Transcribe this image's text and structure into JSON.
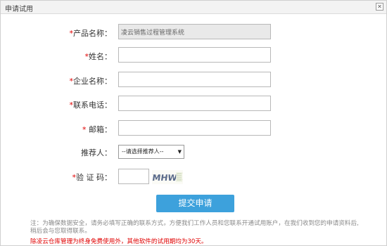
{
  "window": {
    "title": "申请试用",
    "close_icon": "close-icon",
    "close_glyph": "✕"
  },
  "form": {
    "product_name": {
      "required_mark": "*",
      "label": "产品名称：",
      "value": "凌云销售过程管理系统"
    },
    "name": {
      "required_mark": "*",
      "label": "姓名：",
      "value": ""
    },
    "company": {
      "required_mark": "*",
      "label": "企业名称：",
      "value": ""
    },
    "phone": {
      "required_mark": "*",
      "label": "联系电话：",
      "value": ""
    },
    "email": {
      "required_mark": "*",
      "label": " 邮箱：",
      "value": ""
    },
    "referrer": {
      "required_mark": "",
      "label": "推荐人：",
      "selected": "--请选择推荐人--"
    },
    "captcha": {
      "required_mark": "*",
      "label": "验 证 码：",
      "value": "",
      "image_text": "MHW"
    }
  },
  "submit_label": "提交申请",
  "notes": {
    "info": "注：为确保数据安全，请务必填写正确的联系方式，方便我们工作人员和您联系开通试用账户，在我们收到您的申请资料后,稍后会与您取得联系。",
    "warning": "除凌云仓库管理为终身免费使用外，其他软件的试用期均为30天。"
  },
  "colors": {
    "accent": "#3da1dc",
    "required": "#e00000"
  }
}
